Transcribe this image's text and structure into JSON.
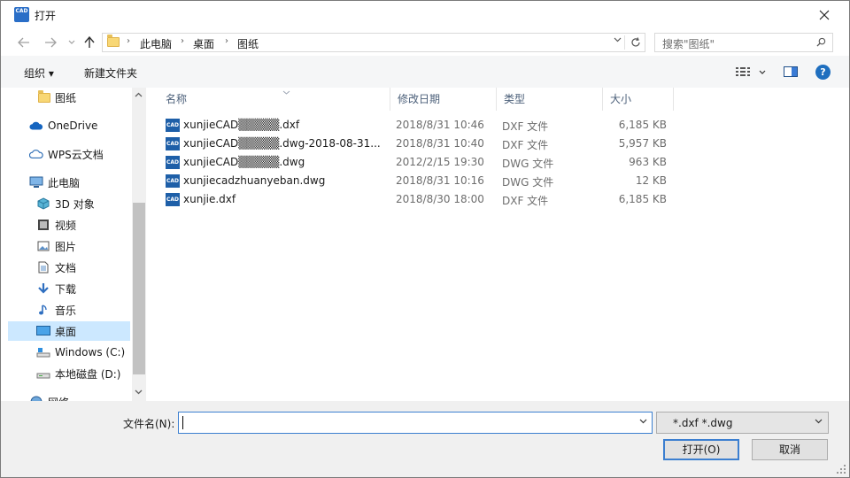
{
  "window": {
    "title": "打开",
    "app_icon_label": "CAD"
  },
  "nav": {
    "back_icon": "arrow-left-icon",
    "forward_icon": "arrow-right-icon",
    "up_icon": "arrow-up-icon"
  },
  "breadcrumb": [
    "此电脑",
    "桌面",
    "图纸"
  ],
  "search": {
    "placeholder": "搜索\"图纸\""
  },
  "toolbar": {
    "organize_label": "组织 ▾",
    "new_folder_label": "新建文件夹",
    "help_label": "?"
  },
  "sidebar": {
    "items": [
      {
        "label": "图纸",
        "icon": "folder-icon"
      },
      {
        "label": "OneDrive",
        "icon": "cloud-icon"
      },
      {
        "label": "WPS云文档",
        "icon": "cloud-outline-icon"
      },
      {
        "label": "此电脑",
        "icon": "computer-icon"
      },
      {
        "label": "3D 对象",
        "icon": "cube-icon"
      },
      {
        "label": "视频",
        "icon": "video-icon"
      },
      {
        "label": "图片",
        "icon": "picture-icon"
      },
      {
        "label": "文档",
        "icon": "document-icon"
      },
      {
        "label": "下载",
        "icon": "download-icon"
      },
      {
        "label": "音乐",
        "icon": "music-icon"
      },
      {
        "label": "桌面",
        "icon": "desktop-icon"
      },
      {
        "label": "Windows (C:)",
        "icon": "drive-icon"
      },
      {
        "label": "本地磁盘 (D:)",
        "icon": "drive-icon"
      },
      {
        "label": "网络",
        "icon": "network-icon"
      }
    ]
  },
  "columns": {
    "name": "名称",
    "date": "修改日期",
    "type": "类型",
    "size": "大小"
  },
  "files": [
    {
      "name": "xunjieCAD▒▒▒▒▒.dxf",
      "date": "2018/8/31 10:46",
      "type": "DXF 文件",
      "size": "6,185 KB",
      "icon_label": "CAD"
    },
    {
      "name": "xunjieCAD▒▒▒▒▒.dwg-2018-08-31...",
      "date": "2018/8/31 10:40",
      "type": "DXF 文件",
      "size": "5,957 KB",
      "icon_label": "CAD"
    },
    {
      "name": "xunjieCAD▒▒▒▒▒.dwg",
      "date": "2012/2/15 19:30",
      "type": "DWG 文件",
      "size": "963 KB",
      "icon_label": "CAD"
    },
    {
      "name": "xunjiecadzhuanyeban.dwg",
      "date": "2018/8/31 10:16",
      "type": "DWG 文件",
      "size": "12 KB",
      "icon_label": "CAD"
    },
    {
      "name": "xunjie.dxf",
      "date": "2018/8/30 18:00",
      "type": "DXF 文件",
      "size": "6,185 KB",
      "icon_label": "CAD"
    }
  ],
  "bottom": {
    "filename_label": "文件名(N):",
    "filename_value": "",
    "filter_value": "*.dxf *.dwg",
    "open_label": "打开(O)",
    "cancel_label": "取消"
  }
}
